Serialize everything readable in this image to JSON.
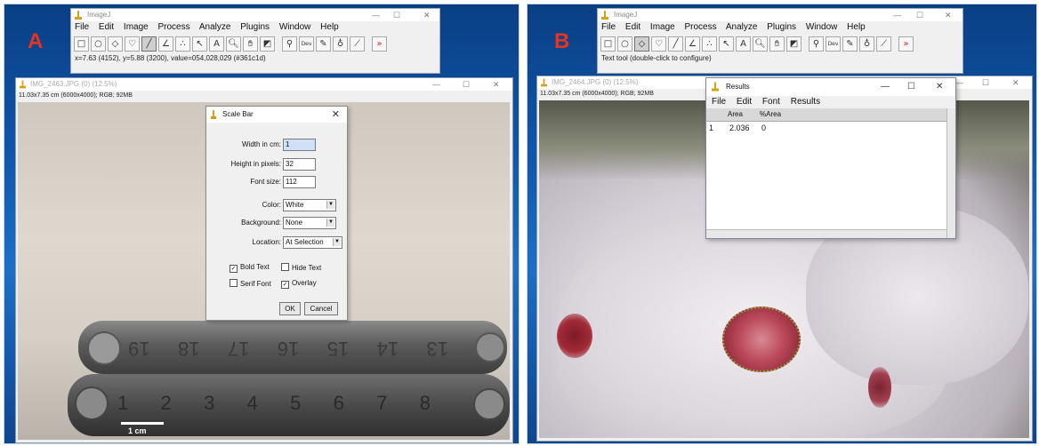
{
  "panel_a": {
    "label": "A",
    "toolbar": {
      "title": "ImageJ",
      "menus": [
        "File",
        "Edit",
        "Image",
        "Process",
        "Analyze",
        "Plugins",
        "Window",
        "Help"
      ],
      "status": "x=7.63 (4152), y=5.88 (3200), value=054,028,029 (#361c1d)"
    },
    "image_window": {
      "title": "IMG_2463.JPG (0) (12.5%)",
      "info": "11.03x7.35 cm (6000x4000); RGB; 92MB"
    },
    "scale_bar_dialog": {
      "title": "Scale Bar",
      "close": "✕",
      "width_label": "Width in cm:",
      "width_value": "1",
      "height_label": "Height in pixels:",
      "height_value": "32",
      "font_label": "Font size:",
      "font_value": "112",
      "color_label": "Color:",
      "color_value": "White",
      "background_label": "Background:",
      "background_value": "None",
      "location_label": "Location:",
      "location_value": "At Selection",
      "bold_text": "Bold Text",
      "hide_text": "Hide Text",
      "serif_font": "Serif Font",
      "overlay": "Overlay",
      "ok": "OK",
      "cancel": "Cancel"
    },
    "ruler_top_numbers": [
      "19",
      "18",
      "17",
      "16",
      "15",
      "14",
      "13"
    ],
    "ruler_bottom_numbers": [
      "1",
      "2",
      "3",
      "4",
      "5",
      "6",
      "7",
      "8"
    ],
    "scale_label": "1 cm"
  },
  "panel_b": {
    "label": "B",
    "toolbar": {
      "title": "ImageJ",
      "menus": [
        "File",
        "Edit",
        "Image",
        "Process",
        "Analyze",
        "Plugins",
        "Window",
        "Help"
      ],
      "status": "Text tool (double-click to configure)"
    },
    "image_window": {
      "title": "IMG_2464.JPG (0) (12.5%)",
      "info": "11.03x7.35 cm (6000x4000); RGB; 92MB"
    },
    "results": {
      "title": "Results",
      "menus": [
        "File",
        "Edit",
        "Font",
        "Results"
      ],
      "columns": [
        "Area",
        "%Area"
      ],
      "rows": [
        [
          "1",
          "2.036",
          "0"
        ]
      ]
    }
  },
  "window_controls": {
    "minimize": "—",
    "maximize": "☐",
    "close": "✕"
  },
  "toolbar_icons": [
    "rectangle-tool-icon",
    "oval-tool-icon",
    "polygon-tool-icon",
    "freehand-tool-icon",
    "line-tool-icon",
    "angle-tool-icon",
    "point-tool-icon",
    "wand-tool-icon",
    "text-tool-icon",
    "magnifier-tool-icon",
    "hand-tool-icon",
    "color-picker-icon",
    "zoom-icon",
    "dev-icon",
    "pencil-icon",
    "dropper-icon",
    "brush-icon",
    "more-tools-icon"
  ],
  "colors": {
    "desktop": "#0f57ad",
    "accent_red": "#e8331e"
  }
}
